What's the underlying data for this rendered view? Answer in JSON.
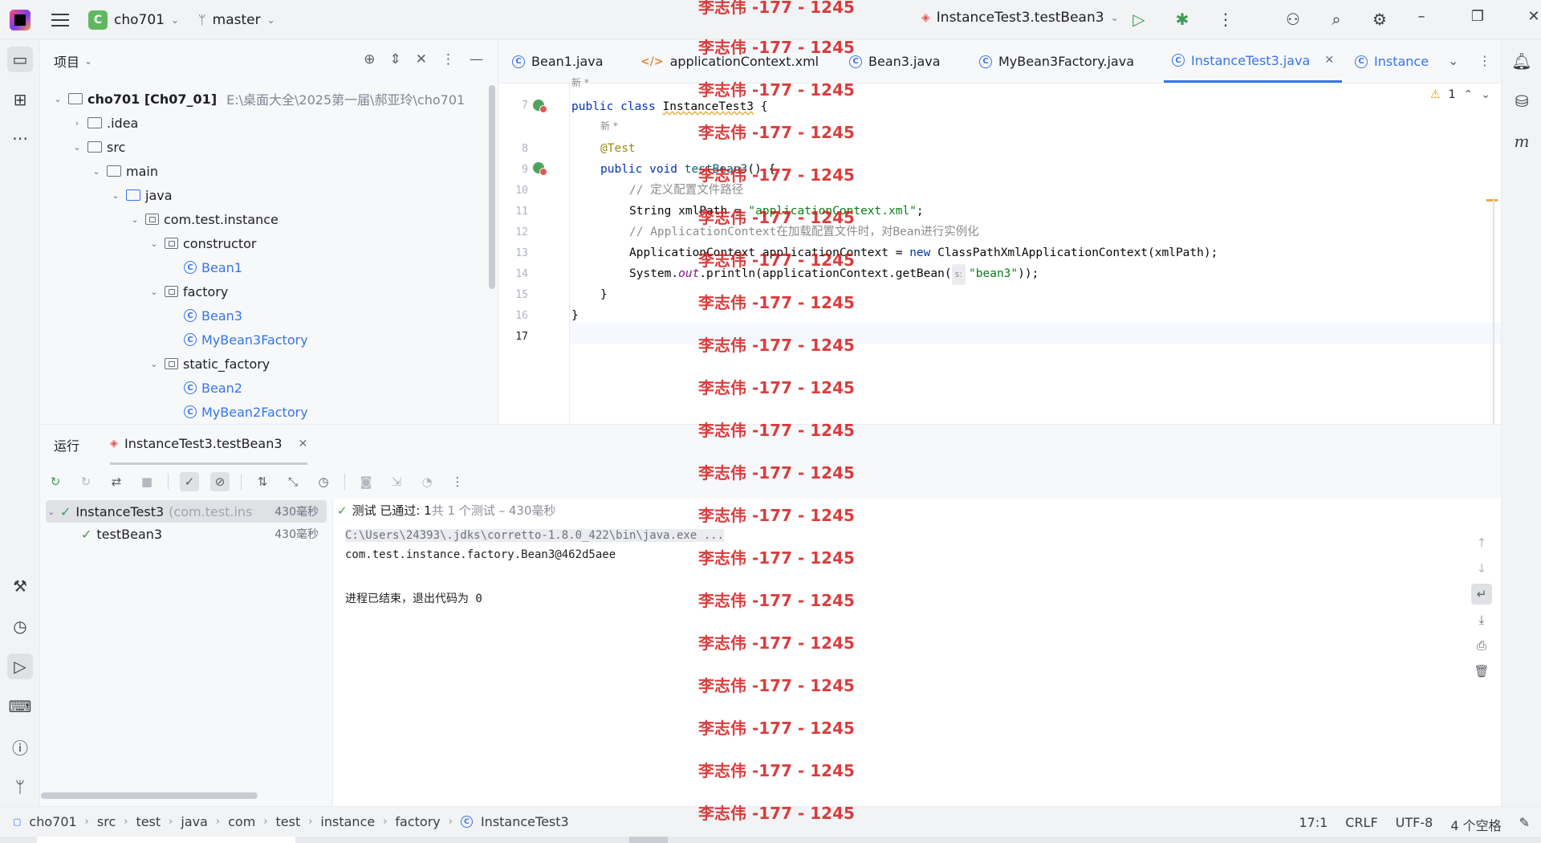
{
  "titlebar": {
    "project_badge": "C",
    "project_name": "cho701",
    "branch": "master",
    "run_config": "InstanceTest3.testBean3"
  },
  "project_panel": {
    "title": "项目",
    "tree": [
      {
        "label": "cho701 [Ch07_01]",
        "path": "E:\\桌面大全\\2025第一届\\郝亚玲\\cho701"
      },
      {
        "label": ".idea"
      },
      {
        "label": "src"
      },
      {
        "label": "main"
      },
      {
        "label": "java"
      },
      {
        "label": "com.test.instance"
      },
      {
        "label": "constructor"
      },
      {
        "label": "Bean1"
      },
      {
        "label": "factory"
      },
      {
        "label": "Bean3"
      },
      {
        "label": "MyBean3Factory"
      },
      {
        "label": "static_factory"
      },
      {
        "label": "Bean2"
      },
      {
        "label": "MyBean2Factory"
      }
    ]
  },
  "editor": {
    "tabs": [
      {
        "label": "Bean1.java"
      },
      {
        "label": "applicationContext.xml"
      },
      {
        "label": "Bean3.java"
      },
      {
        "label": "MyBean3Factory.java"
      },
      {
        "label": "InstanceTest3.java"
      },
      {
        "label": "Instance"
      }
    ],
    "warning_count": "1",
    "hint_new": "新 *",
    "line_numbers": [
      "7",
      "8",
      "9",
      "10",
      "11",
      "12",
      "13",
      "14",
      "15",
      "16",
      "17"
    ],
    "code": {
      "l7_kw": "public class ",
      "l7_name": "InstanceTest3",
      "l7_rest": " {",
      "l8": "@Test",
      "l9_kw": "public void ",
      "l9_fn": "testBean3",
      "l9_rest": "() {",
      "l10": "// 定义配置文件路径",
      "l11_a": "String xmlPath = ",
      "l11_str": "\"applicationContext.xml\"",
      "l11_b": ";",
      "l12": "// ApplicationContext在加载配置文件时，对Bean进行实例化",
      "l13_a": "ApplicationContext applicationContext = ",
      "l13_kw": "new",
      "l13_b": " ClassPathXmlApplicationContext(xmlPath);",
      "l14_a": "System.",
      "l14_it": "out",
      "l14_b": ".println(applicationContext.getBean(",
      "l14_hint": "s:",
      "l14_str": "\"bean3\"",
      "l14_c": "));",
      "l15": "}",
      "l16": "}"
    }
  },
  "run_panel": {
    "title": "运行",
    "tab": "InstanceTest3.testBean3",
    "tests": [
      {
        "label": "InstanceTest3",
        "pkg": "(com.test.ins",
        "duration": "430毫秒"
      },
      {
        "label": "testBean3",
        "duration": "430毫秒"
      }
    ],
    "status_pass": "测试 已通过: 1",
    "status_rest": "共 1 个测试 – 430毫秒",
    "console": {
      "cmd": "C:\\Users\\24393\\.jdks\\corretto-1.8.0_422\\bin\\java.exe ...",
      "out": "com.test.instance.factory.Bean3@462d5aee",
      "exit": "进程已结束，退出代码为 0"
    }
  },
  "statusbar": {
    "crumbs": [
      "cho701",
      "src",
      "test",
      "java",
      "com",
      "test",
      "instance",
      "factory",
      "InstanceTest3"
    ],
    "position": "17:1",
    "line_sep": "CRLF",
    "encoding": "UTF-8",
    "indent": "4 个空格"
  },
  "watermark": "李志伟 -177 - 1245",
  "colors": {
    "accent": "#3574f0",
    "pass": "#3e9a52",
    "watermark": "#d21414"
  }
}
